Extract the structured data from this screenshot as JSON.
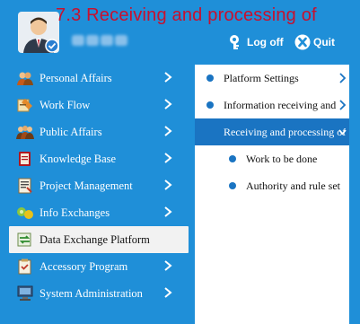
{
  "header": {
    "title": "7.3 Receiving and processing of",
    "logoff_label": "Log off",
    "quit_label": "Quit"
  },
  "left_menu": [
    {
      "label": "Personal Affairs",
      "icon": "personal-affairs-icon"
    },
    {
      "label": "Work Flow",
      "icon": "workflow-icon"
    },
    {
      "label": "Public Affairs",
      "icon": "public-affairs-icon"
    },
    {
      "label": "Knowledge Base",
      "icon": "knowledge-base-icon"
    },
    {
      "label": "Project Management",
      "icon": "project-management-icon"
    },
    {
      "label": "Info Exchanges",
      "icon": "info-exchanges-icon"
    },
    {
      "label": "Data Exchange Platform",
      "icon": "data-exchange-icon",
      "active": true
    },
    {
      "label": "Accessory Program",
      "icon": "accessory-program-icon"
    },
    {
      "label": "System Administration",
      "icon": "system-administration-icon"
    }
  ],
  "submenu": [
    {
      "label": "Platform Settings",
      "has_arrow": true
    },
    {
      "label": "Information receiving and",
      "has_arrow": true
    },
    {
      "label": "Receiving and processing of",
      "selected": true,
      "has_arrow": true
    },
    {
      "label": "Work to be done"
    },
    {
      "label": "Authority and rule set"
    }
  ],
  "colors": {
    "background": "#1f8fd8",
    "title": "#c8102e",
    "selected": "#1a74c2",
    "active_menu": "#f2f2f2"
  }
}
